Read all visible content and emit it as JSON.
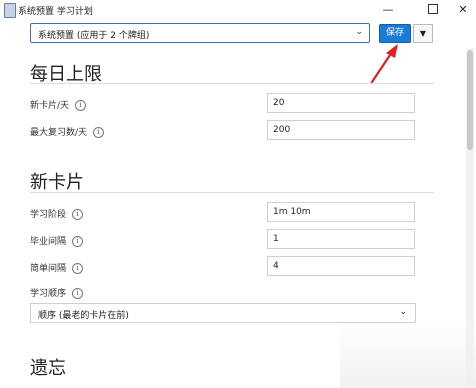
{
  "window": {
    "title": "系统预置 学习计划",
    "minimize": "—",
    "close": "✕"
  },
  "toolbar": {
    "preset_value": "系统预置 (应用于 2 个牌组)",
    "save_label": "保存",
    "menu_arrow": "▼"
  },
  "sections": {
    "daily_limits": {
      "title": "每日上限",
      "new_cards_label": "新卡片/天",
      "new_cards_value": "20",
      "max_reviews_label": "最大复习数/天",
      "max_reviews_value": "200"
    },
    "new_cards": {
      "title": "新卡片",
      "learning_steps_label": "学习阶段",
      "learning_steps_value": "1m 10m",
      "graduating_label": "毕业间隔",
      "graduating_value": "1",
      "easy_label": "简单间隔",
      "easy_value": "4",
      "order_label": "学习顺序",
      "order_value": "顺序 (最老的卡片在前)"
    },
    "lapses": {
      "title": "遗忘"
    }
  },
  "icons": {
    "info": "i",
    "chevron": "⌄"
  },
  "colors": {
    "accent": "#1b7bd9",
    "arrow": "#e02020"
  }
}
